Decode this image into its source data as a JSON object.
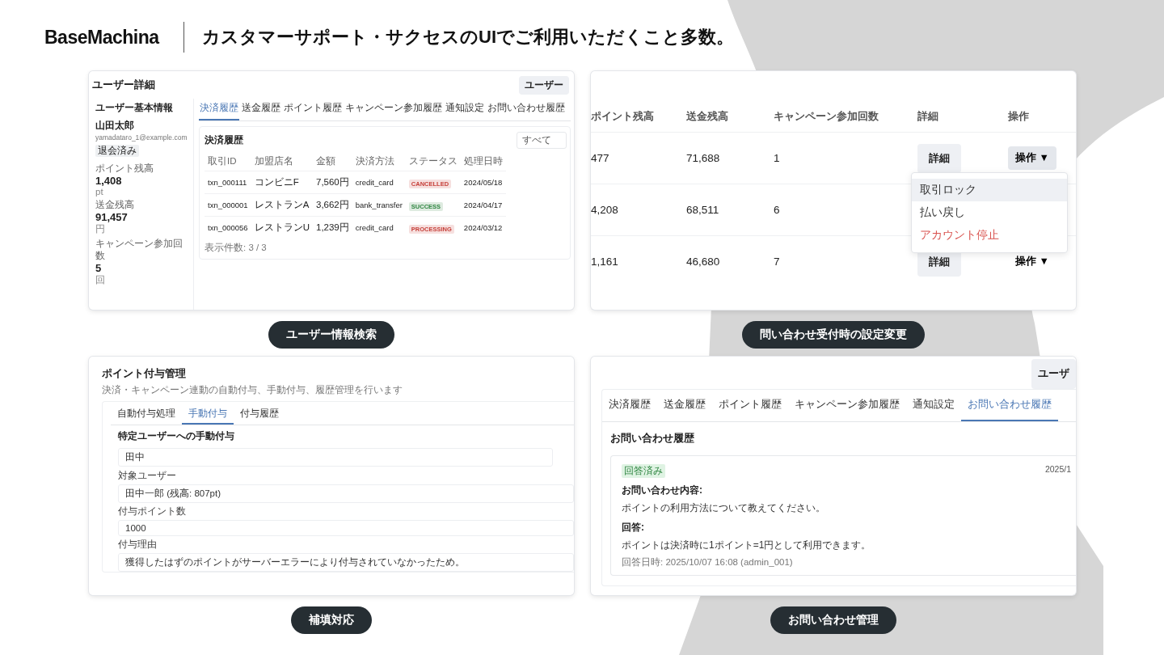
{
  "header": {
    "logo": "BaseMachina",
    "title": "カスタマーサポート・サクセスのUIでご利用いただくこと多数。"
  },
  "cards": [
    {
      "kind": "user_detail",
      "caption": "ユーザー情報検索",
      "title": "ユーザー詳細",
      "top_button": "ユーザー",
      "sidebar": {
        "heading": "ユーザー基本情報",
        "name": "山田太郎",
        "email": "yamadataro_1@example.com",
        "badge": "退会済み",
        "stats": [
          {
            "label": "ポイント残高",
            "value": "1,408",
            "unit": "pt"
          },
          {
            "label": "送金残高",
            "value": "91,457",
            "unit": "円"
          },
          {
            "label": "キャンペーン参加回数",
            "value": "5",
            "unit": "回"
          }
        ]
      },
      "tabs": [
        {
          "label": "決済履歴",
          "selected": true
        },
        {
          "label": "送金履歴",
          "selected": false
        },
        {
          "label": "ポイント履歴",
          "selected": false
        },
        {
          "label": "キャンペーン参加履歴",
          "selected": false
        },
        {
          "label": "通知設定",
          "selected": false
        },
        {
          "label": "お問い合わせ履歴",
          "selected": false
        }
      ],
      "section_title": "決済履歴",
      "filter": "すべて",
      "columns": [
        "取引ID",
        "加盟店名",
        "金額",
        "決済方法",
        "ステータス",
        "処理日時"
      ],
      "rows": [
        {
          "id": "txn_000111",
          "store": "コンビニF",
          "amount": "7,560円",
          "method": "credit_card",
          "status": "CANCELLED",
          "color": "#c6403a",
          "date": "2024/05/18"
        },
        {
          "id": "txn_000001",
          "store": "レストランA",
          "amount": "3,662円",
          "method": "bank_transfer",
          "status": "SUCCESS",
          "color": "#2e8540",
          "date": "2024/04/17"
        },
        {
          "id": "txn_000056",
          "store": "レストランU",
          "amount": "1,239円",
          "method": "credit_card",
          "status": "PROCESSING",
          "color": "#c6403a",
          "date": "2024/03/12"
        }
      ],
      "footer": "表示件数: 3 / 3"
    },
    {
      "kind": "user_list",
      "caption": "問い合わせ受付時の設定変更",
      "columns": [
        "ポイント残高",
        "送金残高",
        "キャンペーン参加回数",
        "詳細",
        "操作"
      ],
      "rows": [
        {
          "points": "477",
          "balance": "71,688",
          "campaigns": "1",
          "detail_button": "詳細",
          "action_button": "操作 ▼",
          "open": true
        },
        {
          "points": "4,208",
          "balance": "68,511",
          "campaigns": "6"
        },
        {
          "points": "1,161",
          "balance": "46,680",
          "campaigns": "7",
          "detail_button": "詳細",
          "action_button": "操作 ▼",
          "open": false
        }
      ],
      "menu": [
        {
          "label": "取引ロック",
          "selected": true,
          "kind": "normal"
        },
        {
          "label": "払い戻し",
          "selected": false,
          "kind": "normal"
        },
        {
          "label": "アカウント停止",
          "selected": false,
          "kind": "danger"
        }
      ]
    },
    {
      "kind": "point_grant",
      "caption": "補填対応",
      "title": "ポイント付与管理",
      "subtitle": "決済・キャンペーン連動の自動付与、手動付与、履歴管理を行います",
      "tabs": [
        {
          "label": "自動付与処理",
          "selected": false
        },
        {
          "label": "手動付与",
          "selected": true
        },
        {
          "label": "付与履歴",
          "selected": false
        }
      ],
      "section_title": "特定ユーザーへの手動付与",
      "search_value": "田中",
      "fields": [
        {
          "label": "対象ユーザー",
          "value": "田中一郎 (残高: 807pt)"
        },
        {
          "label": "付与ポイント数",
          "value": "1000"
        },
        {
          "label": "付与理由",
          "value": "獲得したはずのポイントがサーバーエラーにより付与されていなかったため。"
        }
      ]
    },
    {
      "kind": "inquiry",
      "caption": "お問い合わせ管理",
      "top_button": "ユーザ",
      "tabs": [
        {
          "label": "決済履歴",
          "selected": false
        },
        {
          "label": "送金履歴",
          "selected": false
        },
        {
          "label": "ポイント履歴",
          "selected": false
        },
        {
          "label": "キャンペーン参加履歴",
          "selected": false
        },
        {
          "label": "通知設定",
          "selected": false
        },
        {
          "label": "お問い合わせ履歴",
          "selected": true
        }
      ],
      "section_title": "お問い合わせ履歴",
      "entry": {
        "badge": "回答済み",
        "date": "2025/1",
        "question_label": "お問い合わせ内容:",
        "question": "ポイントの利用方法について教えてください。",
        "answer_label": "回答:",
        "answer": "ポイントは決済時に1ポイント=1円として利用できます。",
        "meta": "回答日時: 2025/10/07 16:08 (admin_001)"
      }
    }
  ]
}
